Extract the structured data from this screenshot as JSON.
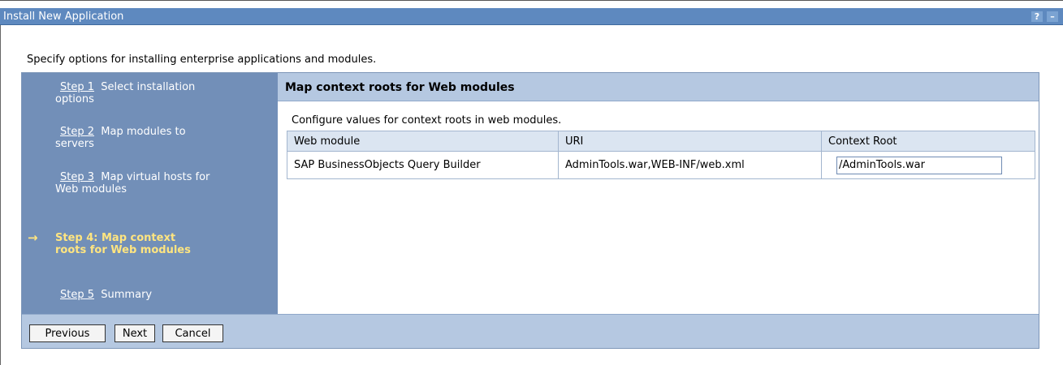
{
  "window": {
    "title": "Install New Application",
    "help_glyph": "?",
    "minimize_glyph": "–"
  },
  "intro_text": "Specify options for installing enterprise applications and modules.",
  "steps": [
    {
      "link": "Step 1",
      "text": "Select installation options"
    },
    {
      "link": "Step 2",
      "text": "Map modules to servers"
    },
    {
      "link": "Step 3",
      "text": "Map virtual hosts for Web modules"
    },
    {
      "arrow": "→",
      "text": "Step 4: Map context roots for Web modules"
    },
    {
      "link": "Step 5",
      "text": "Summary"
    }
  ],
  "main": {
    "title": "Map context roots for Web modules",
    "description": "Configure values for context roots in web modules.",
    "columns": [
      "Web module",
      "URI",
      "Context Root"
    ],
    "rows": [
      {
        "web_module": "SAP BusinessObjects Query Builder",
        "uri": "AdminTools.war,WEB-INF/web.xml",
        "context_root": "/AdminTools.war"
      }
    ]
  },
  "buttons": {
    "previous": "Previous",
    "next": "Next",
    "cancel": "Cancel"
  }
}
